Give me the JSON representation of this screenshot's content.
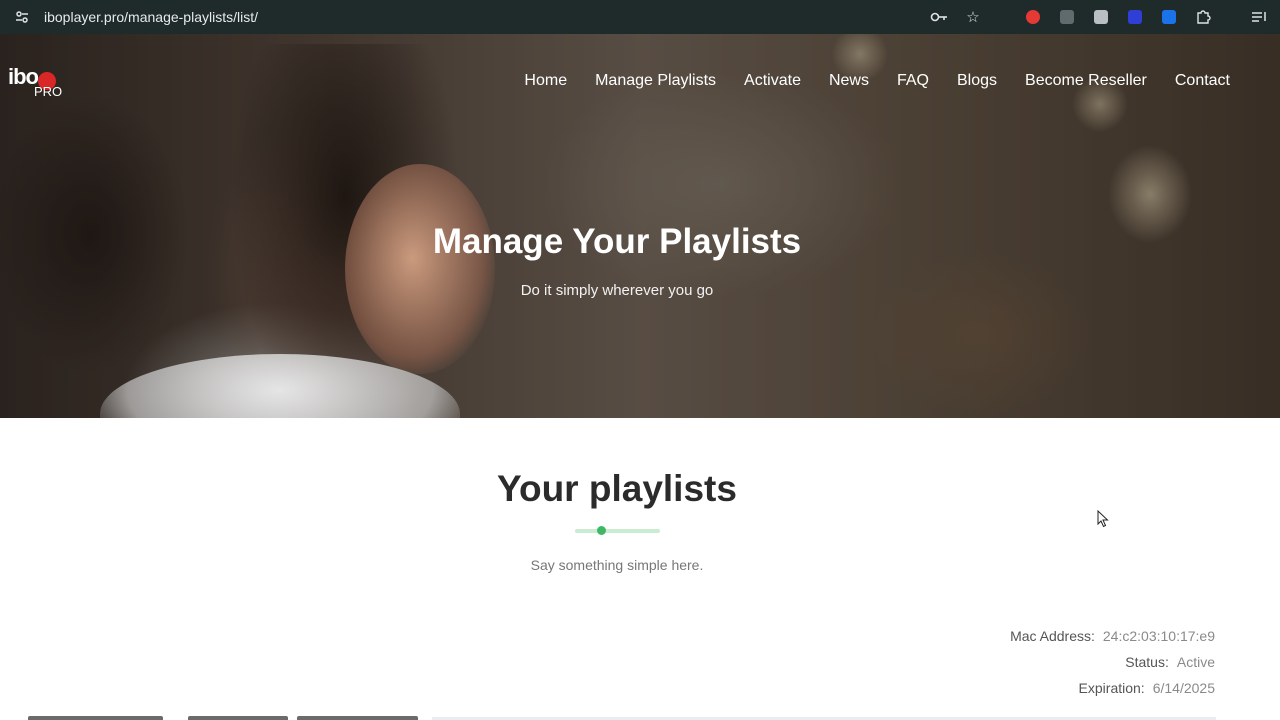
{
  "browser": {
    "url": "iboplayer.pro/manage-playlists/list/",
    "icons": [
      "site-info-icon",
      "password-key-icon",
      "bookmark-star-icon",
      "extension-red-icon",
      "extension-copy-icon",
      "extension-k-icon",
      "extension-blue-icon",
      "extension-download-icon",
      "extensions-puzzle-icon",
      "reading-list-icon"
    ]
  },
  "logo": {
    "top": "ibo",
    "bottom": "PRO"
  },
  "nav": {
    "items": [
      "Home",
      "Manage Playlists",
      "Activate",
      "News",
      "FAQ",
      "Blogs",
      "Become Reseller",
      "Contact"
    ]
  },
  "hero": {
    "title": "Manage Your Playlists",
    "subtitle": "Do it simply wherever you go"
  },
  "section": {
    "title": "Your playlists",
    "subtitle": "Say something simple here."
  },
  "device": {
    "mac_label": "Mac Address:",
    "mac_value": "24:c2:03:10:17:e9",
    "status_label": "Status:",
    "status_value": "Active",
    "expiration_label": "Expiration:",
    "expiration_value": "6/14/2025"
  },
  "colors": {
    "accent": "#3fb866",
    "brand_red": "#d92626",
    "chrome_bg": "#1f2a2b"
  }
}
